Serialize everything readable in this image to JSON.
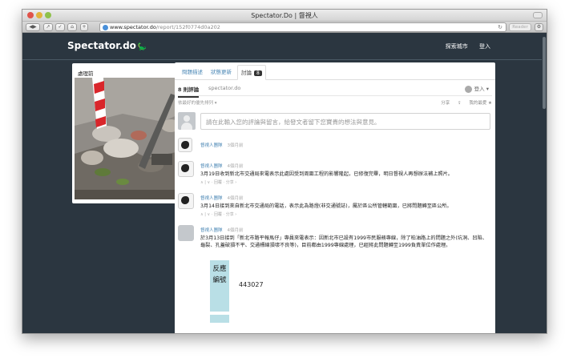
{
  "window": {
    "title": "Spectator.Do | 督視人",
    "url_host": "www.spectator.do",
    "url_path": "/report/152f0774d0a202",
    "reader_label": "Reader"
  },
  "header": {
    "logo_text": "Spectator.do",
    "nav": [
      "探索城市",
      "登入"
    ]
  },
  "photo_card": {
    "label": "處理前"
  },
  "tabs": [
    {
      "label": "問題描述",
      "active": false
    },
    {
      "label": "狀態更新",
      "active": false
    },
    {
      "label": "討論",
      "active": true,
      "badge": "8"
    }
  ],
  "discussion": {
    "count_label": "8 則評論",
    "brand": "spectator.do",
    "login_label": "登入 ▾",
    "sort_label": "依最好的優先排列 ▾",
    "share_label": "分享",
    "fav_label": "我的最愛 ★",
    "input_placeholder": "請在此輸入您的評論與留言，給發文者留下您寶貴的想法與意見。"
  },
  "comments": [
    {
      "author": "督視人團隊",
      "time": "3個月前",
      "text": "",
      "actions": ""
    },
    {
      "author": "督視人團隊",
      "time": "4個月前",
      "text": "3月19日收到新北市交通局來電表示此處因受到周圍工程的影響隆起，已修復完畢，明日督視人再想辦法補上照片。",
      "actions": "∧ | ∨ · 回覆 · 分享 ›"
    },
    {
      "author": "督視人團隊",
      "time": "4個月前",
      "text": "3月14日接到來自新北市交通局的電話，表示此為路燈(非交通號誌)，屬於區公所管轄範圍，已將問題轉至區公所。",
      "actions": "∧ | ∨ · 回覆 · 分享 ›"
    },
    {
      "author": "督視人團隊",
      "time": "4個月前",
      "text": "於3月13日接到「新北市路平報馬仔」專員來電表示：因新北市已設有1999市民服務專線，除了柏油路上的問題之外(坑洞、凹陷、龜裂、孔蓋破損不平、交通標線損壞不良等)，目前都由1999專線處理，已經將此問題轉至1999負責單位作處理。",
      "actions": ""
    }
  ],
  "response_table": {
    "header_label": "反應編號",
    "value": "443027"
  }
}
